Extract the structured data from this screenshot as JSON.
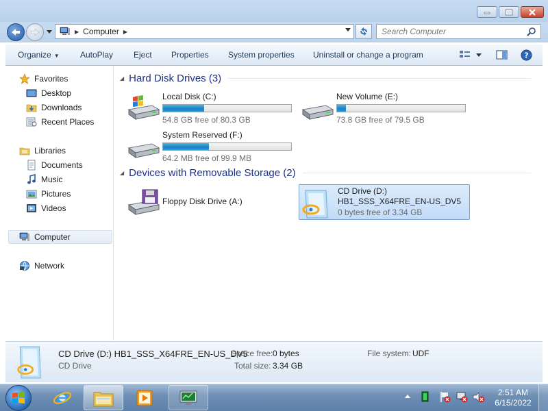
{
  "window": {
    "minimize_icon": "minimize-icon",
    "maximize_icon": "maximize-icon",
    "close_icon": "close-icon"
  },
  "address": {
    "crumb": "Computer",
    "search_placeholder": "Search Computer"
  },
  "commands": {
    "organize": "Organize",
    "autoplay": "AutoPlay",
    "eject": "Eject",
    "properties": "Properties",
    "system_properties": "System properties",
    "uninstall": "Uninstall or change a program"
  },
  "sidebar": {
    "favorites": "Favorites",
    "desktop": "Desktop",
    "downloads": "Downloads",
    "recent_places": "Recent Places",
    "libraries": "Libraries",
    "documents": "Documents",
    "music": "Music",
    "pictures": "Pictures",
    "videos": "Videos",
    "computer": "Computer",
    "network": "Network"
  },
  "groups": {
    "hard_disks": "Hard Disk Drives (3)",
    "removable": "Devices with Removable Storage (2)"
  },
  "drives": [
    {
      "name": "Local Disk (C:)",
      "free": "54.8 GB free of 80.3 GB",
      "used_fraction": 0.32
    },
    {
      "name": "New Volume (E:)",
      "free": "73.8 GB free of 79.5 GB",
      "used_fraction": 0.07
    },
    {
      "name": "System Reserved (F:)",
      "free": "64.2 MB free of 99.9 MB",
      "used_fraction": 0.36
    },
    {
      "name": "Floppy Disk Drive (A:)"
    },
    {
      "name": "CD Drive (D:)",
      "label": "HB1_SSS_X64FRE_EN-US_DV5",
      "free": "0 bytes free of 3.34 GB"
    }
  ],
  "details": {
    "title": "CD Drive (D:) HB1_SSS_X64FRE_EN-US_DV5",
    "type": "CD Drive",
    "space_free_label": "Space free:",
    "space_free": "0 bytes",
    "total_size_label": "Total size:",
    "total_size": "3.34 GB",
    "filesystem_label": "File system:",
    "filesystem": "UDF"
  },
  "taskbar": {
    "time": "2:51 AM",
    "date": "6/15/2022"
  },
  "colors": {
    "accent": "#1e3287",
    "progress": "#1b82c4",
    "selection": "#c2dcf8"
  }
}
